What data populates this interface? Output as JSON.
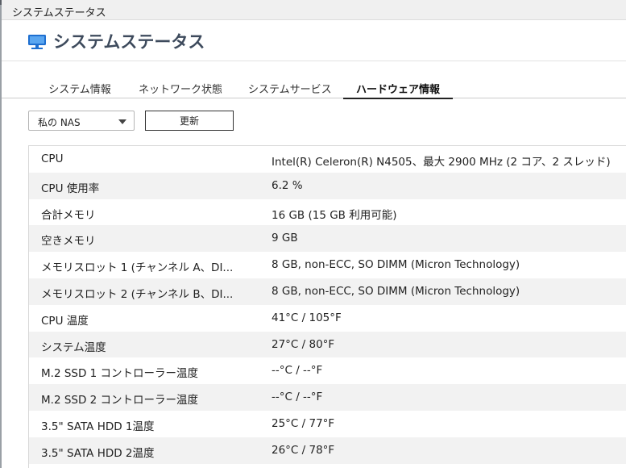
{
  "window": {
    "title": "システムステータス"
  },
  "header": {
    "icon": "monitor-icon",
    "title": "システムステータス",
    "icon_color": "#1e6fd0"
  },
  "tabs": [
    {
      "label": "システム情報",
      "active": false
    },
    {
      "label": "ネットワーク状態",
      "active": false
    },
    {
      "label": "システムサービス",
      "active": false
    },
    {
      "label": "ハードウェア情報",
      "active": true
    }
  ],
  "toolbar": {
    "device_select": {
      "value": "私の NAS",
      "icon": "chevron-down-icon"
    },
    "refresh_label": "更新"
  },
  "hardware_table": {
    "rows": [
      {
        "label": "CPU",
        "value": "Intel(R) Celeron(R) N4505、最大 2900 MHz (2 コア、2 スレッド)"
      },
      {
        "label": "CPU 使用率",
        "value": "6.2 %"
      },
      {
        "label": "合計メモリ",
        "value": "16 GB (15 GB 利用可能)"
      },
      {
        "label": "空きメモリ",
        "value": "9 GB"
      },
      {
        "label": "メモリスロット 1 (チャンネル A、DI...",
        "value": "8 GB, non-ECC, SO DIMM (Micron Technology)"
      },
      {
        "label": "メモリスロット 2 (チャンネル B、DI...",
        "value": "8 GB, non-ECC, SO DIMM (Micron Technology)"
      },
      {
        "label": "CPU 温度",
        "value": "41°C / 105°F"
      },
      {
        "label": "システム温度",
        "value": "27°C / 80°F"
      },
      {
        "label": "M.2 SSD 1 コントローラー温度",
        "value": "--°C / --°F"
      },
      {
        "label": "M.2 SSD 2 コントローラー温度",
        "value": "--°C / --°F"
      },
      {
        "label": "3.5\" SATA HDD 1温度",
        "value": "25°C / 77°F"
      },
      {
        "label": "3.5\" SATA HDD 2温度",
        "value": "26°C / 78°F"
      }
    ]
  },
  "colors": {
    "accent": "#1e6fd0",
    "title_text": "#3d4a5c",
    "row_alt": "#f2f2f2"
  }
}
